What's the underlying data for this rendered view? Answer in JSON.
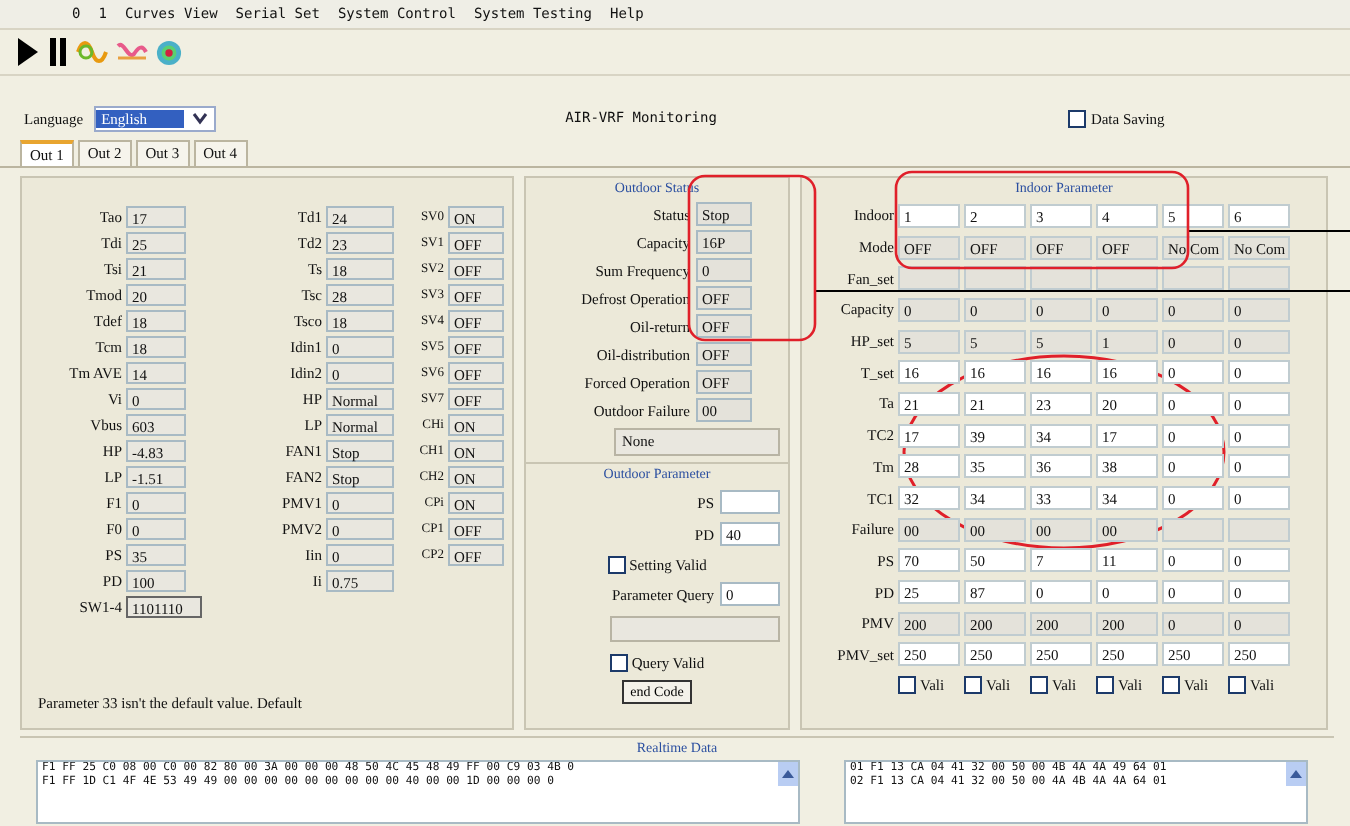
{
  "menu": [
    "0",
    "1",
    "Curves View",
    "Serial Set",
    "System Control",
    "System Testing",
    "Help"
  ],
  "language": {
    "label": "Language",
    "value": "English"
  },
  "title": "AIR-VRF Monitoring",
  "data_saving": {
    "label": "Data Saving",
    "checked": false
  },
  "tabs": [
    {
      "label": "Out 1",
      "selected": true
    },
    {
      "label": "Out 2",
      "selected": false
    },
    {
      "label": "Out 3",
      "selected": false
    },
    {
      "label": "Out 4",
      "selected": false
    }
  ],
  "unit_values": [
    [
      {
        "label": "Tao",
        "value": "17"
      },
      {
        "label": "Tdi",
        "value": "25"
      },
      {
        "label": "Tsi",
        "value": "21"
      },
      {
        "label": "Tmod",
        "value": "20"
      },
      {
        "label": "Tdef",
        "value": "18"
      },
      {
        "label": "Tcm",
        "value": "18"
      },
      {
        "label": "Tm AVE",
        "value": "14"
      },
      {
        "label": "Vi",
        "value": "0"
      },
      {
        "label": "Vbus",
        "value": "603"
      },
      {
        "label": "HP",
        "value": "-4.83"
      },
      {
        "label": "LP",
        "value": "-1.51"
      },
      {
        "label": "F1",
        "value": "0"
      },
      {
        "label": "F0",
        "value": "0"
      },
      {
        "label": "PS",
        "value": "35"
      },
      {
        "label": "PD",
        "value": "100"
      },
      {
        "label": "SW1-4",
        "value": "1101110"
      }
    ],
    [
      {
        "label": "Td1",
        "value": "24"
      },
      {
        "label": "Td2",
        "value": "23"
      },
      {
        "label": "Ts",
        "value": "18"
      },
      {
        "label": "Tsc",
        "value": "28"
      },
      {
        "label": "Tsco",
        "value": "18"
      },
      {
        "label": "Idin1",
        "value": "0"
      },
      {
        "label": "Idin2",
        "value": "0"
      },
      {
        "label": "HP",
        "value": "Normal"
      },
      {
        "label": "LP",
        "value": "Normal"
      },
      {
        "label": "FAN1",
        "value": "Stop"
      },
      {
        "label": "FAN2",
        "value": "Stop"
      },
      {
        "label": "PMV1",
        "value": "0"
      },
      {
        "label": "PMV2",
        "value": "0"
      },
      {
        "label": "Iin",
        "value": "0"
      },
      {
        "label": "Ii",
        "value": "0.75"
      }
    ],
    [
      {
        "label": "SV0",
        "value": "ON"
      },
      {
        "label": "SV1",
        "value": "OFF"
      },
      {
        "label": "SV2",
        "value": "OFF"
      },
      {
        "label": "SV3",
        "value": "OFF"
      },
      {
        "label": "SV4",
        "value": "OFF"
      },
      {
        "label": "SV5",
        "value": "OFF"
      },
      {
        "label": "SV6",
        "value": "OFF"
      },
      {
        "label": "SV7",
        "value": "OFF"
      },
      {
        "label": "CHi",
        "value": "ON"
      },
      {
        "label": "CH1",
        "value": "ON"
      },
      {
        "label": "CH2",
        "value": "ON"
      },
      {
        "label": "CPi",
        "value": "ON"
      },
      {
        "label": "CP1",
        "value": "OFF"
      },
      {
        "label": "CP2",
        "value": "OFF"
      }
    ]
  ],
  "message": "Parameter 33 isn't the default value. Default",
  "outdoor_status": {
    "title": "Outdoor Status",
    "rows": [
      {
        "label": "Status",
        "value": "Stop"
      },
      {
        "label": "Capacity",
        "value": "16P"
      },
      {
        "label": "Sum Frequency",
        "value": "0"
      },
      {
        "label": "Defrost Operation",
        "value": "OFF"
      },
      {
        "label": "Oil-return",
        "value": "OFF"
      },
      {
        "label": "Oil-distribution",
        "value": "OFF"
      },
      {
        "label": "Forced Operation",
        "value": "OFF"
      },
      {
        "label": "Outdoor Failure",
        "value": "00"
      }
    ],
    "failure_text": "None"
  },
  "outdoor_parameter": {
    "title": "Outdoor Parameter",
    "ps": {
      "label": "PS"
    },
    "pd": {
      "label": "PD",
      "value": "40"
    },
    "setting_valid": {
      "label": "Setting Valid",
      "checked": false
    },
    "query": {
      "label": "Parameter Query",
      "value": "0"
    },
    "query_valid": {
      "label": "Query Valid",
      "checked": false
    },
    "send_button": "end Code"
  },
  "indoor_parameter": {
    "title": "Indoor Parameter",
    "rows": [
      {
        "label": "Indoor",
        "editable": true,
        "cells": [
          "1",
          "2",
          "3",
          "4",
          "5",
          "6"
        ]
      },
      {
        "label": "Mode",
        "editable": false,
        "cells": [
          "OFF",
          "OFF",
          "OFF",
          "OFF",
          "No Com",
          "No Com"
        ]
      },
      {
        "label": "Fan_set",
        "editable": false,
        "cells": [
          null,
          null,
          null,
          null,
          null,
          null
        ]
      },
      {
        "label": "Capacity",
        "editable": false,
        "cells": [
          "0",
          "0",
          "0",
          "0",
          "0",
          "0"
        ]
      },
      {
        "label": "HP_set",
        "editable": false,
        "cells": [
          "5",
          "5",
          "5",
          "1",
          "0",
          "0"
        ]
      },
      {
        "label": "T_set",
        "editable": true,
        "cells": [
          "16",
          "16",
          "16",
          "16",
          "0",
          "0"
        ]
      },
      {
        "label": "Ta",
        "editable": true,
        "cells": [
          "21",
          "21",
          "23",
          "20",
          "0",
          "0"
        ]
      },
      {
        "label": "TC2",
        "editable": true,
        "cells": [
          "17",
          "39",
          "34",
          "17",
          "0",
          "0"
        ]
      },
      {
        "label": "Tm",
        "editable": true,
        "cells": [
          "28",
          "35",
          "36",
          "38",
          "0",
          "0"
        ]
      },
      {
        "label": "TC1",
        "editable": true,
        "cells": [
          "32",
          "34",
          "33",
          "34",
          "0",
          "0"
        ]
      },
      {
        "label": "Failure",
        "editable": false,
        "cells": [
          "00",
          "00",
          "00",
          "00",
          null,
          null
        ]
      },
      {
        "label": "PS",
        "editable": true,
        "cells": [
          "70",
          "50",
          "7",
          "11",
          "0",
          "0"
        ]
      },
      {
        "label": "PD",
        "editable": true,
        "cells": [
          "25",
          "87",
          "0",
          "0",
          "0",
          "0"
        ]
      },
      {
        "label": "PMV",
        "editable": false,
        "cells": [
          "200",
          "200",
          "200",
          "200",
          "0",
          "0"
        ]
      },
      {
        "label": "PMV_set",
        "editable": true,
        "cells": [
          "250",
          "250",
          "250",
          "250",
          "250",
          "250"
        ]
      }
    ],
    "valid_boxes": [
      {
        "label": "Vali",
        "checked": false
      },
      {
        "label": "Vali",
        "checked": false
      },
      {
        "label": "Vali",
        "checked": false
      },
      {
        "label": "Vali",
        "checked": false
      },
      {
        "label": "Vali",
        "checked": false
      },
      {
        "label": "Vali",
        "checked": false
      }
    ]
  },
  "realtime": {
    "title": "Realtime Data",
    "left_lines": [
      "F1 FF 25 C0 08 00 C0 00 82 80 00 3A 00 00 00 48 50 4C 45 48 49 FF 00 C9 03 4B 0",
      "F1 FF 1D C1 4F 4E 53 49 49 00 00 00 00 00 00 00 00 00 40 00 00 1D 00 00 00 0"
    ],
    "right_lines": [
      "01 F1 13 CA 04 41 32 00 50 00 4B 4A 4A 49 64 01",
      "02 F1 13 CA 04 41 32 00 50 00 4A 4B 4A 4A 64 01"
    ]
  }
}
